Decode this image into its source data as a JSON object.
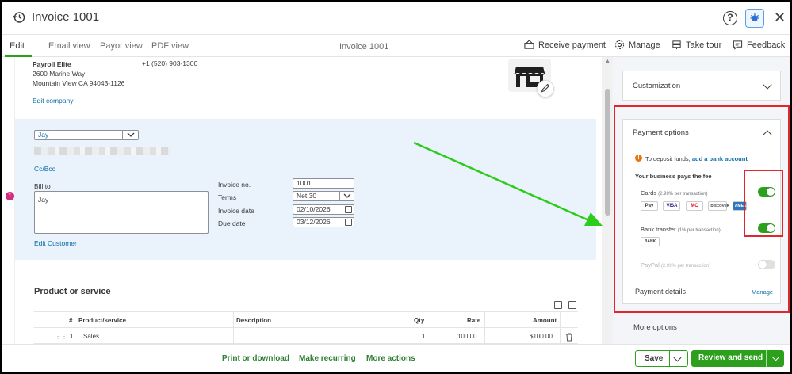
{
  "header": {
    "title": "Invoice 1001",
    "help": "?",
    "close": "✕"
  },
  "tabs": {
    "items": [
      "Edit",
      "Email view",
      "Payor view",
      "PDF view"
    ],
    "center_title": "Invoice 1001",
    "actions": [
      "Receive payment",
      "Manage",
      "Take tour",
      "Feedback"
    ]
  },
  "company": {
    "name": "Payroll Elite",
    "address1": "2600 Marine Way",
    "address2": "Mountain View CA 94043-1126",
    "phone": "+1 (520) 903-1300",
    "edit_link": "Edit company"
  },
  "customer": {
    "selected": "Jay",
    "cc_bcc": "Cc/Bcc",
    "bill_to_label": "Bill to",
    "bill_to_value": "Jay",
    "edit_link": "Edit Customer",
    "badge": "1"
  },
  "invoice_fields": {
    "invoice_no_label": "Invoice no.",
    "invoice_no": "1001",
    "terms_label": "Terms",
    "terms": "Net 30",
    "invoice_date_label": "Invoice date",
    "invoice_date": "02/10/2026",
    "due_date_label": "Due date",
    "due_date": "03/12/2026"
  },
  "products": {
    "title": "Product or service",
    "columns": [
      "#",
      "Product/service",
      "Description",
      "Qty",
      "Rate",
      "Amount"
    ],
    "rows": [
      {
        "num": "1",
        "product": "Sales",
        "description": "",
        "qty": "1",
        "rate": "100.00",
        "amount": "$100.00"
      }
    ]
  },
  "panel": {
    "customization": "Customization",
    "payment_options": "Payment options",
    "deposit_text": "To deposit funds,",
    "deposit_link": "add a bank account",
    "fee_title": "Your business pays the fee",
    "cards_label": "Cards",
    "cards_fee": "(2.99% per transaction)",
    "card_logos": [
      "Pay",
      "VISA",
      "MC",
      "DISCOVER",
      "AMEX"
    ],
    "bank_label": "Bank transfer",
    "bank_fee": "(1% per transaction)",
    "bank_logo": "BANK",
    "paypal_label": "PayPal",
    "paypal_fee": "(2.99% per transaction)",
    "payment_details": "Payment details",
    "manage": "Manage",
    "more_options": "More options",
    "toggles": {
      "cards": true,
      "bank": true,
      "paypal": false
    }
  },
  "footer": {
    "print": "Print or download",
    "recurring": "Make recurring",
    "more": "More actions",
    "save": "Save",
    "review_send": "Review and send"
  },
  "colors": {
    "accent": "#2ca01c",
    "link": "#0d6ba8",
    "highlight": "#e3262e",
    "annotation_arrow": "#2ecc1a"
  }
}
